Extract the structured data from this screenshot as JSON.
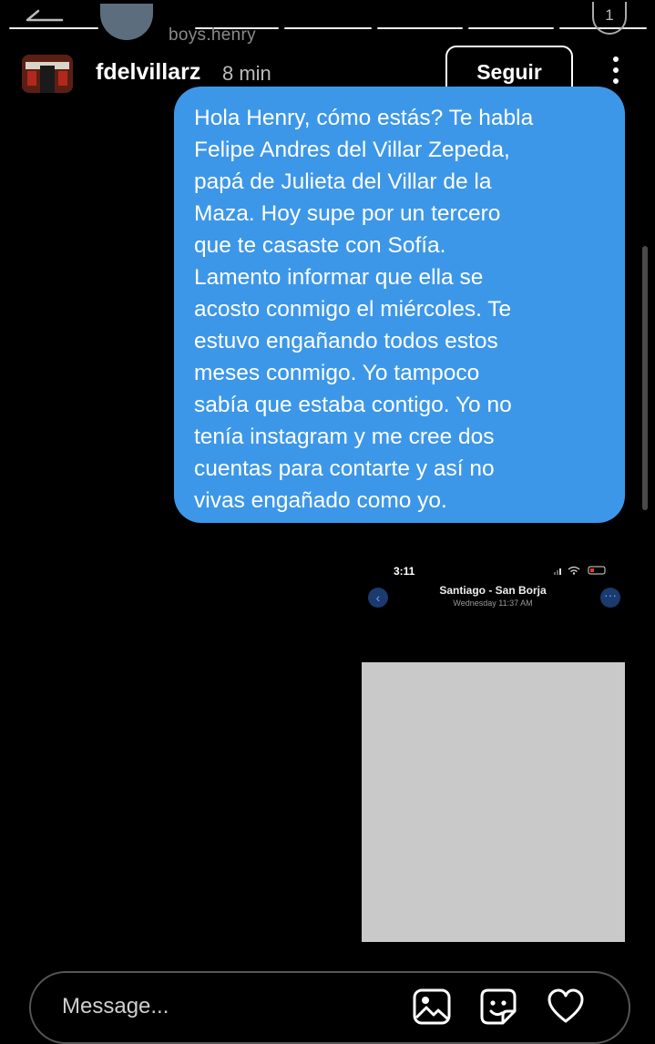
{
  "story": {
    "top_username": "boys.henry",
    "top_badge": "1"
  },
  "header": {
    "username": "fdelvillarz",
    "time": "8 min",
    "follow_label": "Seguir"
  },
  "message": {
    "lines": [
      "Hola Henry, cómo estás? Te habla",
      "Felipe Andres del Villar Zepeda,",
      "papá de Julieta del Villar de la",
      "Maza. Hoy supe por un tercero",
      "que te casaste con Sofía.",
      "Lamento informar que ella se",
      "acosto conmigo el miércoles. Te",
      "estuvo engañando todos estos",
      "meses conmigo. Yo tampoco",
      "sabía que estaba contigo. Yo no",
      "tenía instagram y me cree dos",
      "cuentas para contarte y así no",
      "vivas engañado como yo."
    ],
    "color": "#3d97e8"
  },
  "screenshot": {
    "status_time": "3:11",
    "contact": "Santiago - San Borja",
    "subtitle": "Wednesday 11:37 AM",
    "back_glyph": "‹",
    "more_glyph": "···"
  },
  "composer": {
    "placeholder": "Message...",
    "icons": [
      "gallery-icon",
      "sticker-icon",
      "heart-icon"
    ]
  }
}
